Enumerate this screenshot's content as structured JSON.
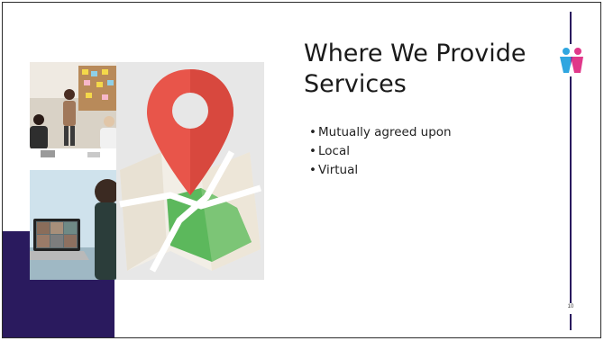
{
  "slide": {
    "title": "Where We Provide Services",
    "bullets": [
      "Mutually agreed upon",
      "Local",
      "Virtual"
    ],
    "slide_number": "10"
  },
  "images": {
    "top_photo": "meeting-photo",
    "bottom_photo": "video-call-photo",
    "map_graphic": "map-pin-icon",
    "logo": "people-logo-icon"
  },
  "colors": {
    "accent": "#2a1a5e",
    "logo_pink": "#e0388a",
    "logo_blue": "#2fa6e0",
    "pin_red": "#e8554a",
    "map_green": "#5cb85c"
  }
}
